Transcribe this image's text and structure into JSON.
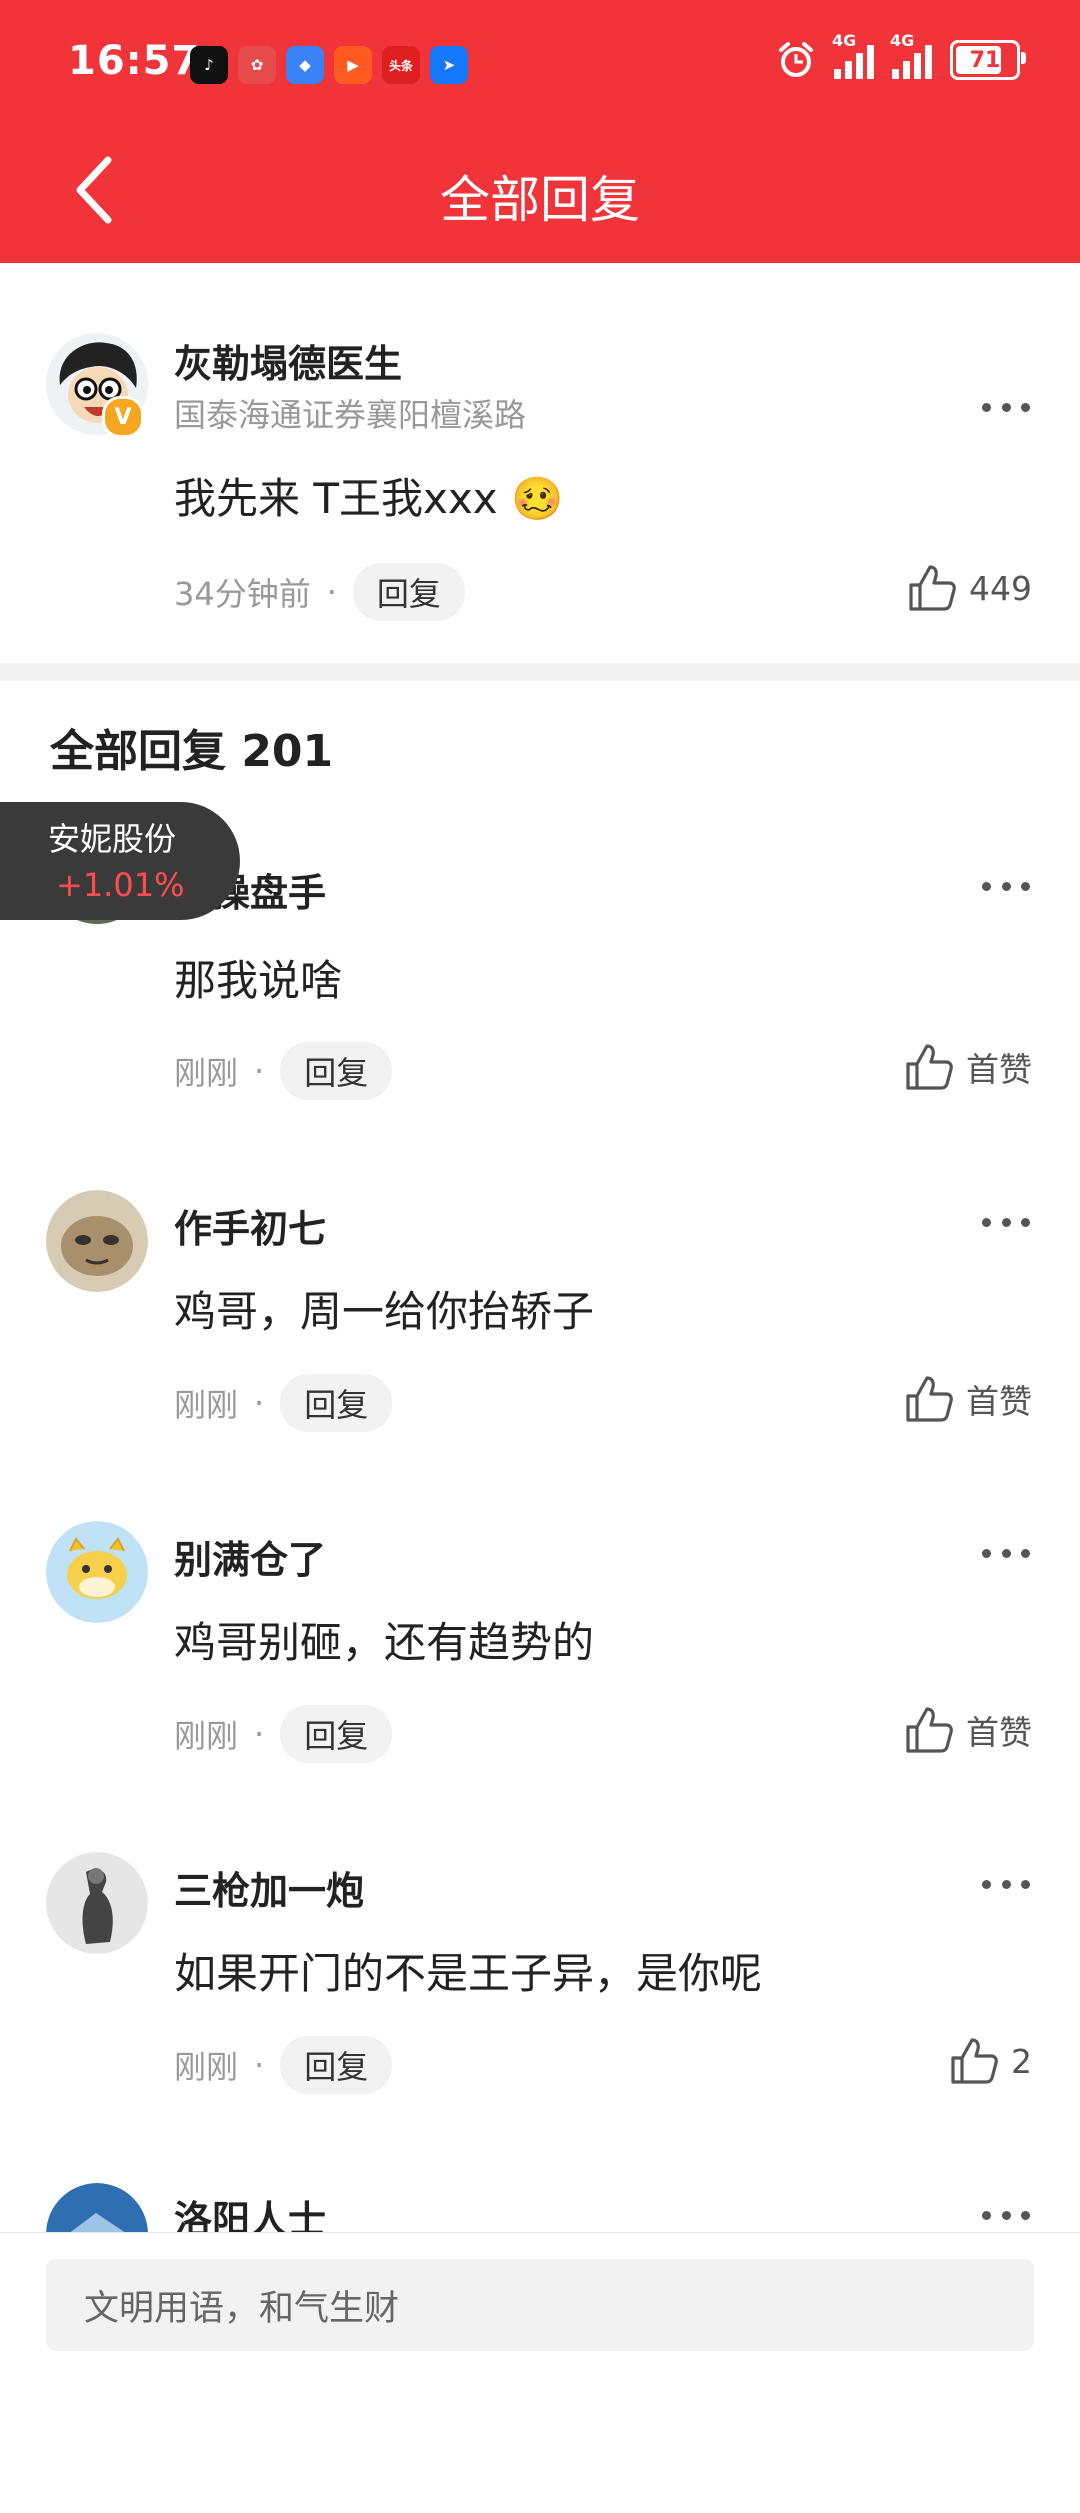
{
  "status_bar": {
    "time": "16:57",
    "apps": [
      {
        "name": "tiktok-app-icon",
        "label": "♪",
        "color": "#111111"
      },
      {
        "name": "game-app-icon",
        "label": "✿",
        "color": "#e84b4b"
      },
      {
        "name": "browser-app-icon",
        "label": "◆",
        "color": "#3b82f6"
      },
      {
        "name": "video-app-icon",
        "label": "▶",
        "color": "#ff5a1f"
      },
      {
        "name": "toutiao-app-icon",
        "label": "头条",
        "color": "#e02020"
      },
      {
        "name": "message-app-icon",
        "label": "➤",
        "color": "#1677ff"
      }
    ],
    "network_1": "4G",
    "network_2": "4G",
    "battery": "71"
  },
  "header": {
    "title": "全部回复"
  },
  "main_post": {
    "author": "灰勒塌德医生",
    "subtitle": "国泰海通证券襄阳檀溪路",
    "content": "我先来 T王我xxx",
    "emoji": "🥴",
    "time": "34分钟前",
    "reply_label": "回复",
    "likes": "449"
  },
  "section": {
    "title": "全部回复 201"
  },
  "floating_stock": {
    "name": "安妮股份",
    "change": "+1.01%"
  },
  "replies": [
    {
      "author": "仓操盘手",
      "content": "那我说啥",
      "time": "刚刚",
      "reply_label": "回复",
      "likes": "首赞"
    },
    {
      "author": "作手初七",
      "content": "鸡哥，周一给你抬轿子",
      "time": "刚刚",
      "reply_label": "回复",
      "likes": "首赞"
    },
    {
      "author": "别满仓了",
      "content": "鸡哥别砸，还有趋势的",
      "time": "刚刚",
      "reply_label": "回复",
      "likes": "首赞"
    },
    {
      "author": "三枪加一炮",
      "content": "如果开门的不是王子异，是你呢",
      "time": "刚刚",
      "reply_label": "回复",
      "likes": "2"
    },
    {
      "author": "洛阳人士"
    }
  ],
  "input": {
    "placeholder": "文明用语，和气生财"
  },
  "colors": {
    "accent": "#f1333a",
    "gray_text": "#999999",
    "pill_bg": "#f2f2f2"
  }
}
